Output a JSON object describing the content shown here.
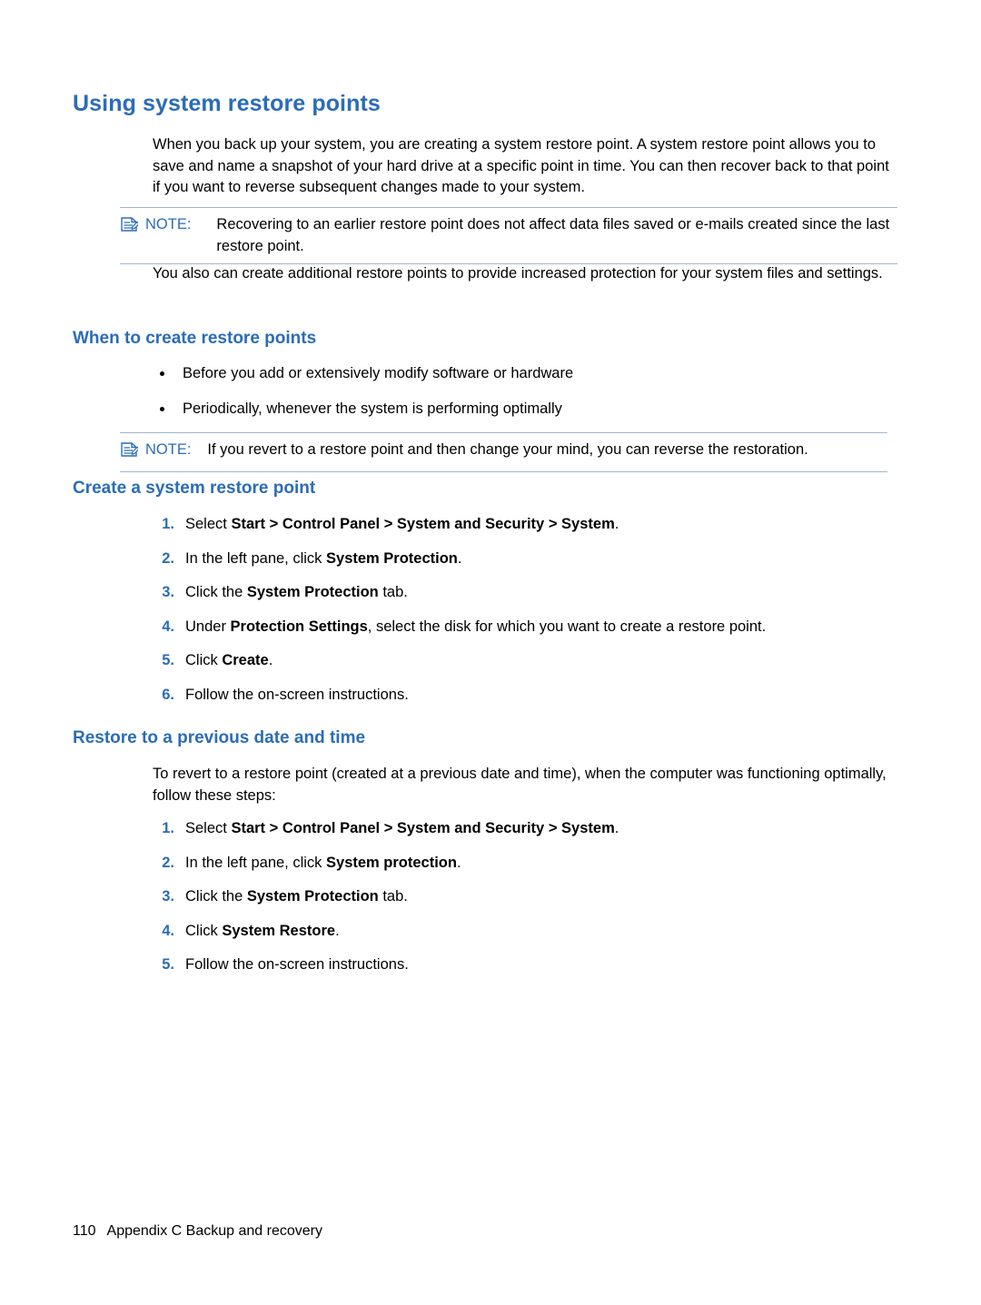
{
  "document": {
    "title": "Using system restore points",
    "intro_paragraph": "When you back up your system, you are creating a system restore point. A system restore point allows you to save and name a snapshot of your hard drive at a specific point in time. You can then recover back to that point if you want to reverse subsequent changes made to your system.",
    "note1": {
      "label": "NOTE:",
      "text": "Recovering to an earlier restore point does not affect data files saved or e-mails created since the last restore point."
    },
    "paragraph2": "You also can create additional restore points to provide increased protection for your system files and settings.",
    "section_when": {
      "heading": "When to create restore points",
      "bullets": [
        "Before you add or extensively modify software or hardware",
        "Periodically, whenever the system is performing optimally"
      ]
    },
    "note2": {
      "label": "NOTE:",
      "text": "If you revert to a restore point and then change your mind, you can reverse the restoration."
    },
    "section_create": {
      "heading": "Create a system restore point",
      "steps": [
        {
          "num": "1.",
          "prefix": "Select ",
          "bold": "Start > Control Panel > System and Security > System",
          "suffix": "."
        },
        {
          "num": "2.",
          "prefix": "In the left pane, click ",
          "bold": "System Protection",
          "suffix": "."
        },
        {
          "num": "3.",
          "prefix": "Click the ",
          "bold": "System Protection",
          "suffix": " tab."
        },
        {
          "num": "4.",
          "prefix": "Under ",
          "bold": "Protection Settings",
          "suffix": ", select the disk for which you want to create a restore point."
        },
        {
          "num": "5.",
          "prefix": "Click ",
          "bold": "Create",
          "suffix": "."
        },
        {
          "num": "6.",
          "prefix": "Follow the on-screen instructions.",
          "bold": "",
          "suffix": ""
        }
      ]
    },
    "section_restore": {
      "heading": "Restore to a previous date and time",
      "paragraph": "To revert to a restore point (created at a previous date and time), when the computer was functioning optimally, follow these steps:",
      "steps": [
        {
          "num": "1.",
          "prefix": "Select ",
          "bold": "Start > Control Panel > System and Security > System",
          "suffix": "."
        },
        {
          "num": "2.",
          "prefix": "In the left pane, click ",
          "bold": "System protection",
          "suffix": "."
        },
        {
          "num": "3.",
          "prefix": "Click the ",
          "bold": "System Protection",
          "suffix": " tab."
        },
        {
          "num": "4.",
          "prefix": "Click ",
          "bold": "System Restore",
          "suffix": "."
        },
        {
          "num": "5.",
          "prefix": "Follow the on-screen instructions.",
          "bold": "",
          "suffix": ""
        }
      ]
    },
    "footer": {
      "page_number": "110",
      "text": "Appendix C   Backup and recovery"
    },
    "colors": {
      "heading_blue": "#2b6cb8",
      "note_rule": "#9fb6cd"
    }
  }
}
